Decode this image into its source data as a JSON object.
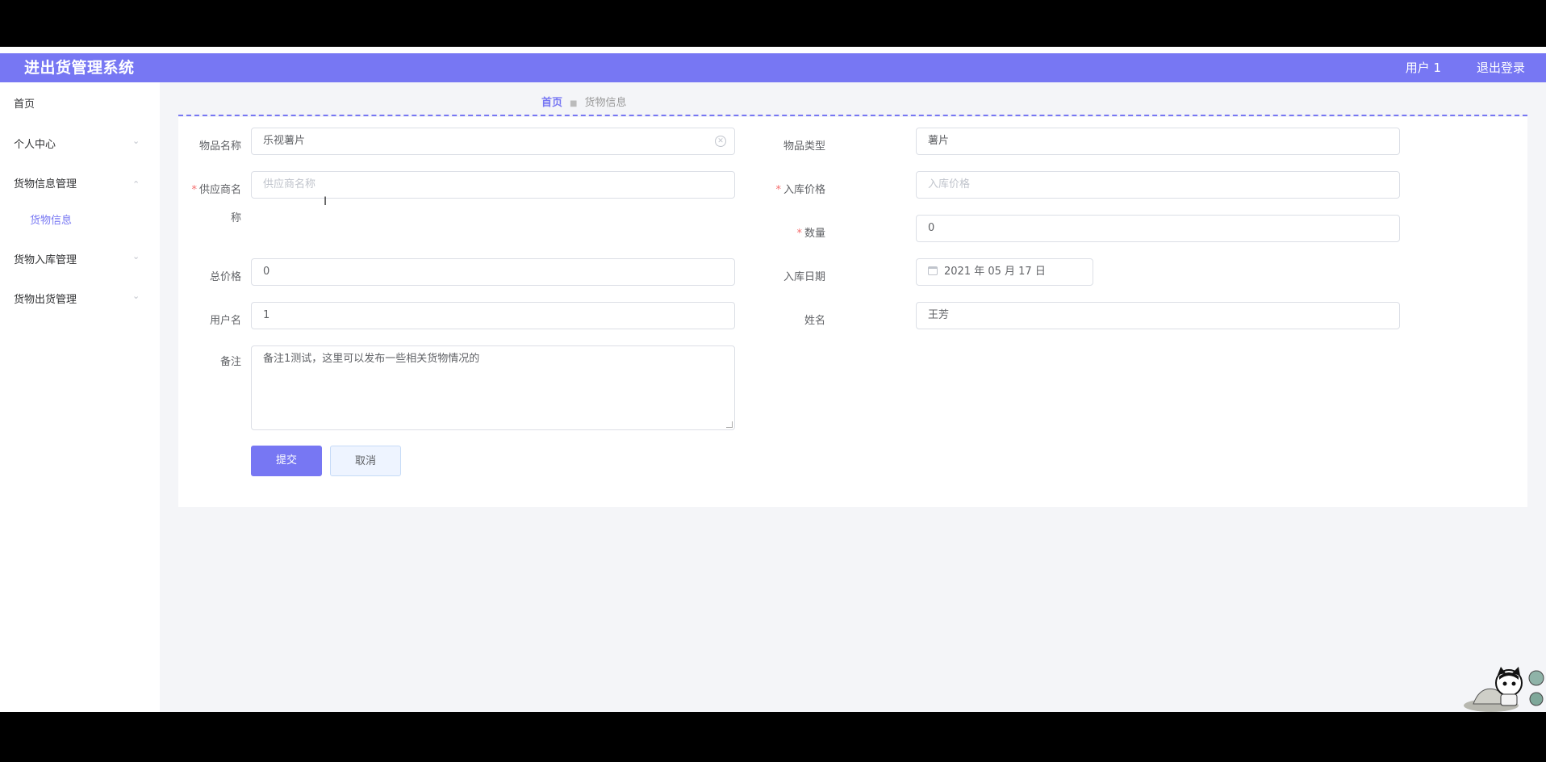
{
  "header": {
    "title": "进出货管理系统",
    "user": "用户 1",
    "logout": "退出登录"
  },
  "sidebar": {
    "items": [
      {
        "label": "首页"
      },
      {
        "label": "个人中心"
      },
      {
        "label": "货物信息管理"
      },
      {
        "label": "货物信息"
      },
      {
        "label": "货物入库管理"
      },
      {
        "label": "货物出货管理"
      }
    ]
  },
  "breadcrumb": {
    "home": "首页",
    "current": "货物信息"
  },
  "form": {
    "item_name_label": "物品名称",
    "item_name_value": "乐视薯片",
    "item_type_label": "物品类型",
    "item_type_value": "薯片",
    "supplier_label": "供应商名",
    "supplier_label_wrap": "称",
    "supplier_placeholder": "供应商名称",
    "in_price_label": "入库价格",
    "in_price_placeholder": "入库价格",
    "quantity_label": "数量",
    "quantity_value": "0",
    "total_label": "总价格",
    "total_value": "0",
    "in_date_label": "入库日期",
    "in_date_value": "2021 年 05 月 17 日",
    "username_label": "用户名",
    "username_value": "1",
    "name_label": "姓名",
    "name_value": "王芳",
    "remark_label": "备注",
    "remark_value": "备注1测试，这里可以发布一些相关货物情况的",
    "submit": "提交",
    "cancel": "取消"
  },
  "colors": {
    "accent": "#7777f3",
    "required": "#f56c6c"
  }
}
